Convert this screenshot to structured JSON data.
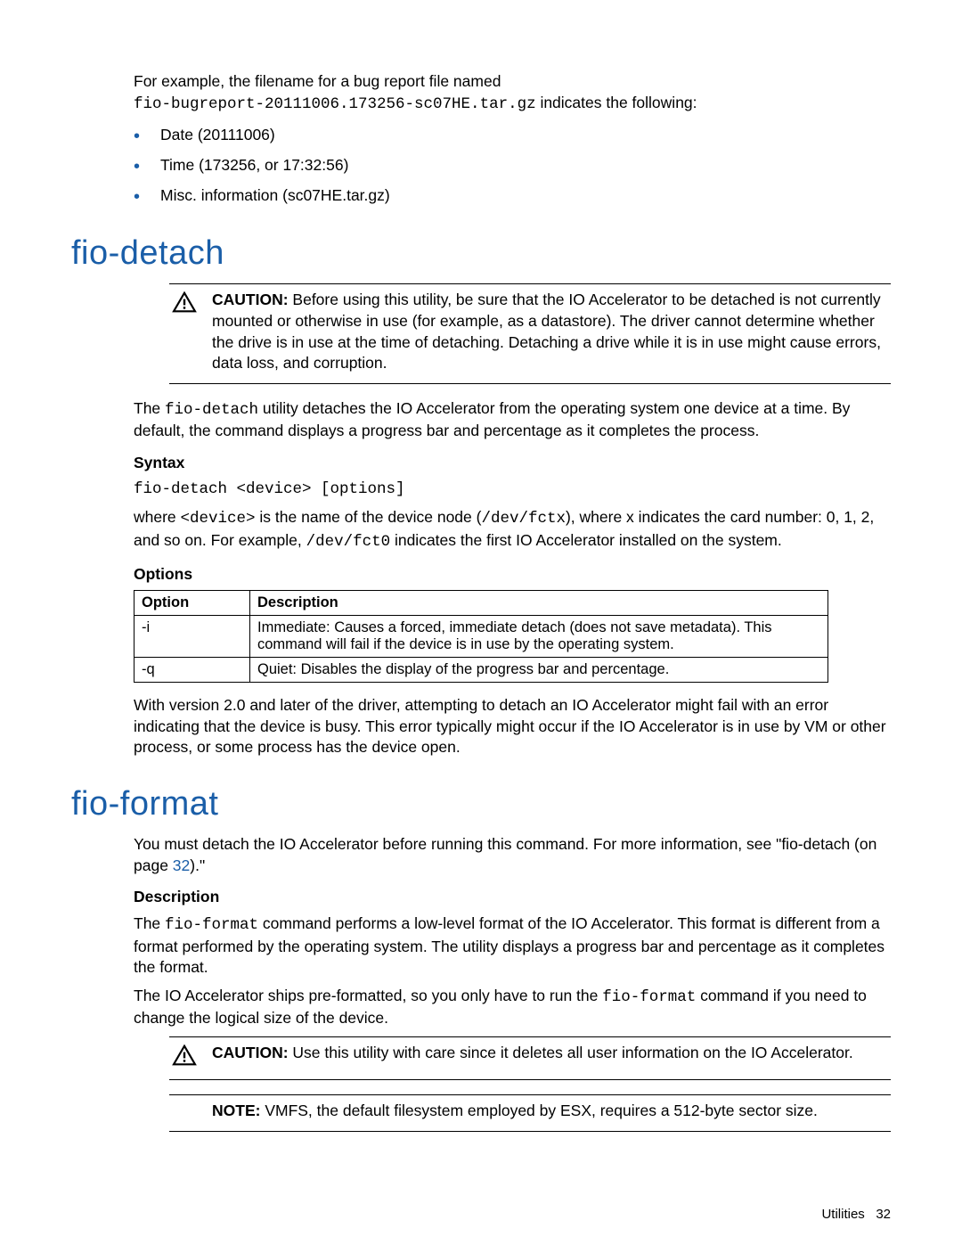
{
  "intro": {
    "line1_pre": "For example, the filename for a bug report file named",
    "filename_code": "fio-bugreport-20111006.173256-sc07HE.tar.gz",
    "line1_post": " indicates the following:",
    "bullets": [
      "Date (20111006)",
      "Time (173256, or 17:32:56)",
      "Misc. information (sc07HE.tar.gz)"
    ]
  },
  "fio_detach": {
    "heading": "fio-detach",
    "caution_label": "CAUTION:",
    "caution_text": "   Before using this utility, be sure that the IO Accelerator to be detached is not currently mounted or otherwise in use (for example, as a datastore). The driver cannot determine whether the drive is in use at the time of detaching. Detaching a drive while it is in use might cause errors, data loss, and corruption.",
    "para1_pre": "The ",
    "para1_code": "fio-detach",
    "para1_post": " utility detaches the IO Accelerator from the operating system one device at a time. By default, the command displays a progress bar and percentage as it completes the process.",
    "syntax_label": "Syntax",
    "syntax_code": "fio-detach <device> [options]",
    "where_pre": "where ",
    "where_code1": "<device>",
    "where_mid1": " is the name of the device node (",
    "where_code2": "/dev/fctx",
    "where_mid2": "), where x indicates the card number: 0, 1, 2, and so on. For example, ",
    "where_code3": "/dev/fct0",
    "where_post": " indicates the first IO Accelerator installed on the system.",
    "options_label": "Options",
    "table": {
      "h1": "Option",
      "h2": "Description",
      "rows": [
        {
          "opt": "-i",
          "desc": "Immediate: Causes a forced, immediate detach (does not save metadata). This command will fail if the device is in use by the operating system."
        },
        {
          "opt": "-q",
          "desc": "Quiet: Disables the display of the progress bar and percentage."
        }
      ]
    },
    "para2": "With version 2.0 and later of the driver, attempting to detach an IO Accelerator might fail with an error indicating that the device is busy. This error typically might occur if the IO Accelerator is in use by VM or other process, or some process has the device open."
  },
  "fio_format": {
    "heading": "fio-format",
    "para1_pre": "You must detach the IO Accelerator before running this command. For more information, see \"fio-detach (on page ",
    "para1_link": "32",
    "para1_post": ").\"",
    "desc_label": "Description",
    "para2_pre": "The ",
    "para2_code": "fio-format",
    "para2_post": " command performs a low-level format of the IO Accelerator. This format is different from a format performed by the operating system. The utility displays a progress bar and percentage as it completes the format.",
    "para3_pre": "The IO Accelerator ships pre-formatted, so you only have to run the ",
    "para3_code": "fio-format",
    "para3_post": " command if you need to change the logical size of the device.",
    "caution_label": "CAUTION:",
    "caution_text": "   Use this utility with care since it deletes all user information on the IO Accelerator.",
    "note_label": "NOTE:",
    "note_text": "  VMFS, the default filesystem employed by ESX, requires a 512-byte sector size."
  },
  "footer": {
    "section": "Utilities",
    "page": "32"
  }
}
